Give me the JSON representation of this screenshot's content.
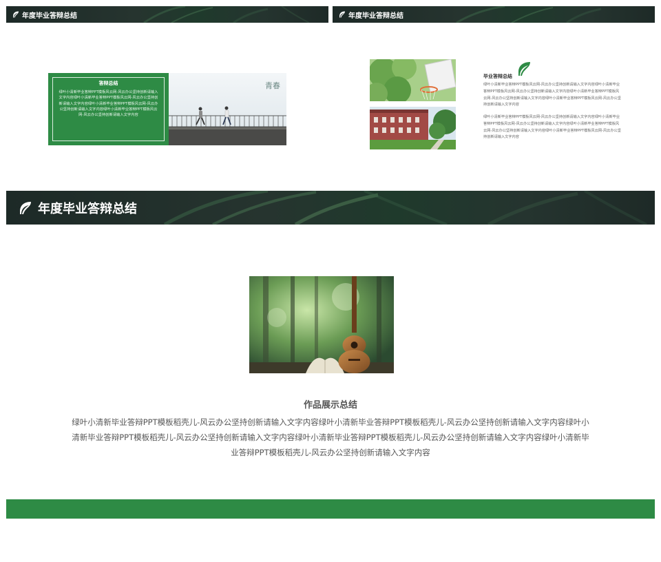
{
  "slides": [
    {
      "header_title": "年度毕业答辩总结",
      "box_title": "答辩总结",
      "box_text": "绿叶小清新毕业答辩PPT模板风云网-风云办公坚持创新请输入文字内容绿叶小清新毕业答辩PPT模板风云网-风云办公坚持创新请输入文字内容绿叶小清新毕业答辩PPT模板风云网-风云办公坚持创新请输入文字内容绿叶小清新毕业答辩PPT模板风云网-风云办公坚持创新请输入文字内容",
      "photo_caption": "青春"
    },
    {
      "header_title": "年度毕业答辩总结",
      "section_title": "毕业答辩总结",
      "para1": "绿叶小清新毕业答辩PPT模板风云网-风云办公坚持创新请输入文字内容绿叶小清新毕业答辩PPT模板风云网-风云办公坚持创新请输入文字内容绿叶小清新毕业答辩PPT模板风云网-风云办公坚持创新请输入文字内容绿叶小清新毕业答辩PPT模板风云网-风云办公坚持创新请输入文字内容",
      "para2": "绿叶小清新毕业答辩PPT模板风云网-风云办公坚持创新请输入文字内容绿叶小清新毕业答辩PPT模板风云网-风云办公坚持创新请输入文字内容绿叶小清新毕业答辩PPT模板风云网-风云办公坚持创新请输入文字内容绿叶小清新毕业答辩PPT模板风云网-风云办公坚持创新请输入文字内容"
    },
    {
      "header_title": "年度毕业答辩总结",
      "section_title": "作品展示总结",
      "paragraph": "绿叶小清新毕业答辩PPT模板稻壳儿-风云办公坚持创新请输入文字内容绿叶小清新毕业答辩PPT模板稻壳儿-风云办公坚持创新请输入文字内容绿叶小清新毕业答辩PPT模板稻壳儿-风云办公坚持创新请输入文字内容绿叶小清新毕业答辩PPT模板稻壳儿-风云办公坚持创新请输入文字内容绿叶小清新毕业答辩PPT模板稻壳儿-风云办公坚持创新请输入文字内容"
    }
  ],
  "colors": {
    "accent_green": "#2e8b45",
    "header_dark": "#1f2b28",
    "body_text": "#555555"
  },
  "icons": {
    "header_icon": "leaf-icon",
    "section_icon": "leaf-icon"
  }
}
